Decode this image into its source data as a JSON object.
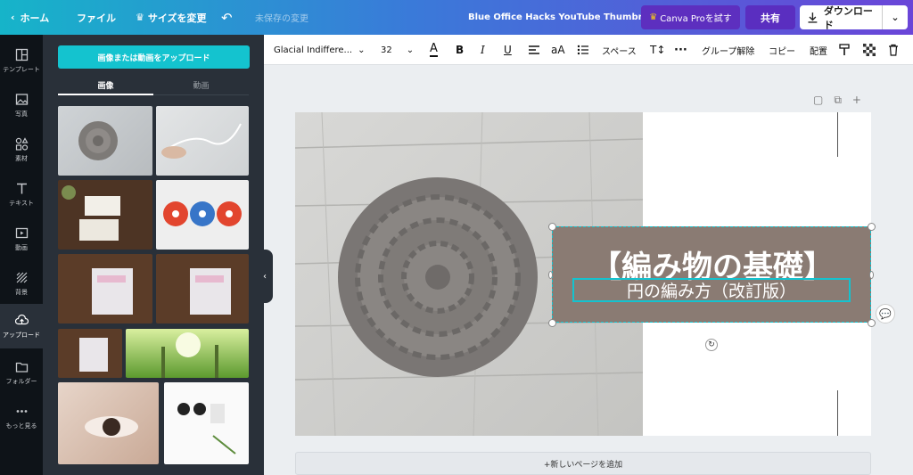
{
  "topbar": {
    "home": "ホーム",
    "file": "ファイル",
    "resize": "サイズを変更",
    "unsaved": "未保存の変更",
    "doc_title": "Blue Office Hacks YouTube Thumbnail",
    "pro": "Canva Proを試す",
    "share": "共有",
    "download": "ダウンロード"
  },
  "rail": [
    {
      "label": "テンプレート",
      "icon": "template-icon"
    },
    {
      "label": "写真",
      "icon": "photo-icon"
    },
    {
      "label": "素材",
      "icon": "elements-icon"
    },
    {
      "label": "テキスト",
      "icon": "text-icon"
    },
    {
      "label": "動画",
      "icon": "video-icon"
    },
    {
      "label": "背景",
      "icon": "background-icon"
    },
    {
      "label": "アップロード",
      "icon": "upload-icon",
      "active": true
    },
    {
      "label": "フォルダー",
      "icon": "folder-icon"
    },
    {
      "label": "もっと見る",
      "icon": "more-icon"
    }
  ],
  "panel": {
    "upload_button": "画像または動画をアップロード",
    "tab_images": "画像",
    "tab_videos": "動画"
  },
  "toolbar": {
    "font_name": "Glacial Indiffere...",
    "font_size": "32",
    "spacing": "スペース",
    "ungroup": "グループ解除",
    "copy": "コピー",
    "arrange": "配置"
  },
  "design": {
    "title": "【編み物の基礎】",
    "subtitle": "円の編み方（改訂版）"
  },
  "add_page": "+新しいページを追加",
  "colors": {
    "accent": "#14c3cf",
    "title_bg": "#8a7b73",
    "rail_bg": "#0e1318",
    "panel_bg": "#293039"
  }
}
